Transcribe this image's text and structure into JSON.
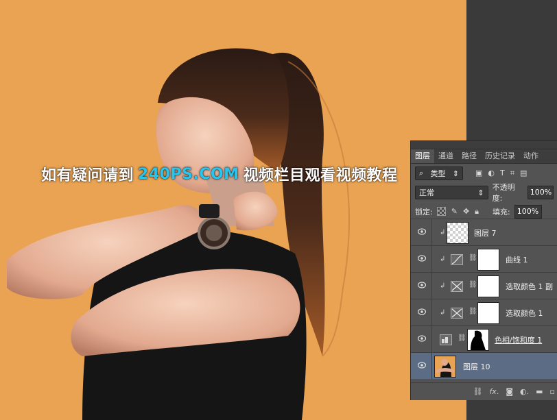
{
  "watermark": {
    "text_before": "如有疑问请到",
    "site": "240PS.COM",
    "text_after": "视频栏目观看视频教程"
  },
  "colors": {
    "canvas_bg": "#e9a352",
    "watermark_site": "#27c6ef",
    "panel_bg": "#535353",
    "selected_row": "#5c6c84"
  },
  "panel": {
    "tabs": [
      {
        "label": "图层"
      },
      {
        "label": "通道"
      },
      {
        "label": "路径"
      },
      {
        "label": "历史记录"
      },
      {
        "label": "动作"
      }
    ],
    "filter": {
      "kind_label": "类型",
      "icons": [
        "image-filter-icon",
        "adjustment-filter-icon",
        "type-filter-icon",
        "shape-filter-icon",
        "smart-object-filter-icon"
      ]
    },
    "blend": {
      "mode": "正常",
      "opacity_label": "不透明度:",
      "opacity_value": "100%"
    },
    "lock": {
      "label": "锁定:",
      "fill_label": "填充:",
      "fill_value": "100%"
    },
    "layers": [
      {
        "name": "图层 7",
        "type": "pixel",
        "clipped": true,
        "visible": true,
        "selected": false
      },
      {
        "name": "曲线 1",
        "type": "curves",
        "clipped": true,
        "visible": true,
        "selected": false
      },
      {
        "name": "选取颜色 1 副",
        "type": "selective-color",
        "clipped": true,
        "visible": true,
        "selected": false
      },
      {
        "name": "选取颜色 1",
        "type": "selective-color",
        "clipped": true,
        "visible": true,
        "selected": false
      },
      {
        "name": "色相/饱和度 1",
        "type": "hue-saturation",
        "clipped": false,
        "visible": true,
        "selected": false
      },
      {
        "name": "图层 10",
        "type": "pixel",
        "clipped": false,
        "visible": true,
        "selected": true
      }
    ]
  }
}
